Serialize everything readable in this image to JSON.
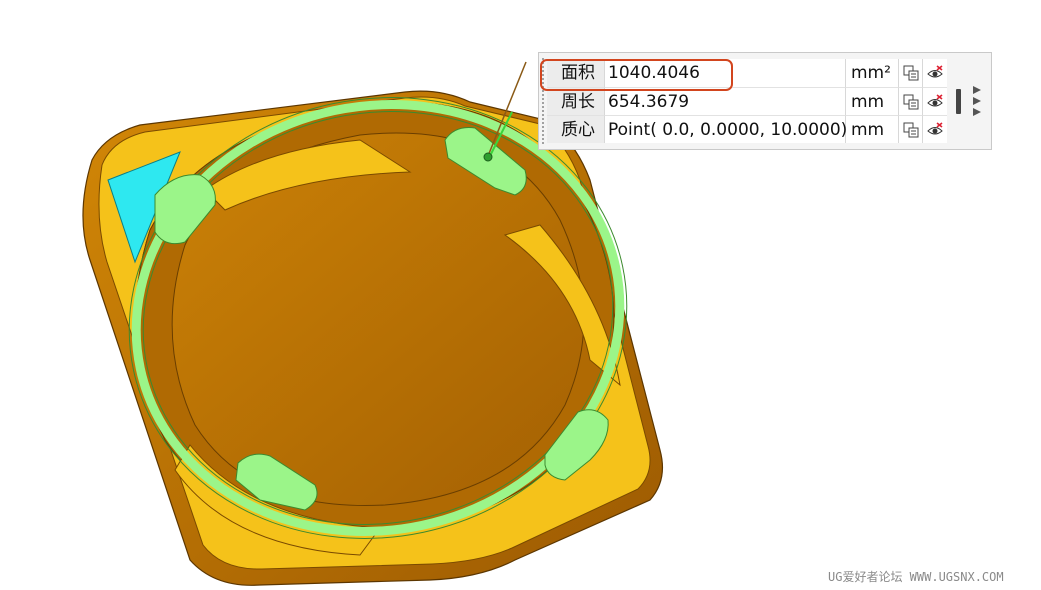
{
  "measure_panel": {
    "rows": [
      {
        "label": "面积",
        "value": "1040.4046",
        "unit": "mm²"
      },
      {
        "label": "周长",
        "value": "654.3679",
        "unit": "mm"
      },
      {
        "label": "质心",
        "value": "Point( 0.0, 0.0000, 10.0000)",
        "unit": "mm"
      }
    ],
    "highlight_color": "#d2451e"
  },
  "model": {
    "part_color": "#f5c21a",
    "side_color": "#c97b05",
    "selected_face_color": "#9bf589",
    "cyan_face_color": "#2ee8f0"
  },
  "watermark": "UG爱好者论坛 WWW.UGSNX.COM"
}
